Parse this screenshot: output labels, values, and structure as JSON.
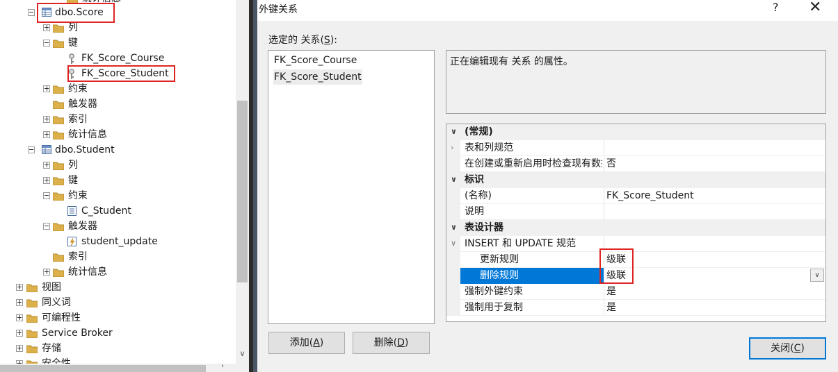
{
  "explorer": {
    "top_partial": "统计信息",
    "nodes": [
      {
        "label": "dbo.Score",
        "expander": "minus",
        "icon": "table"
      },
      {
        "label": "列",
        "expander": "plus",
        "icon": "folder"
      },
      {
        "label": "键",
        "expander": "minus",
        "icon": "folder"
      },
      {
        "label": "FK_Score_Course",
        "icon": "key"
      },
      {
        "label": "FK_Score_Student",
        "icon": "key"
      },
      {
        "label": "约束",
        "expander": "plus",
        "icon": "folder"
      },
      {
        "label": "触发器",
        "icon": "folder"
      },
      {
        "label": "索引",
        "expander": "plus",
        "icon": "folder"
      },
      {
        "label": "统计信息",
        "expander": "plus",
        "icon": "folder"
      },
      {
        "label": "dbo.Student",
        "expander": "minus",
        "icon": "table"
      },
      {
        "label": "列",
        "expander": "plus",
        "icon": "folder"
      },
      {
        "label": "键",
        "expander": "plus",
        "icon": "folder"
      },
      {
        "label": "约束",
        "expander": "minus",
        "icon": "folder"
      },
      {
        "label": "C_Student",
        "icon": "check"
      },
      {
        "label": "触发器",
        "expander": "minus",
        "icon": "folder"
      },
      {
        "label": "student_update",
        "icon": "trigger"
      },
      {
        "label": "索引",
        "icon": "folder"
      },
      {
        "label": "统计信息",
        "expander": "plus",
        "icon": "folder"
      },
      {
        "label": "视图",
        "expander": "plus",
        "icon": "folder"
      },
      {
        "label": "同义词",
        "expander": "plus",
        "icon": "folder"
      },
      {
        "label": "可编程性",
        "expander": "plus",
        "icon": "folder"
      },
      {
        "label": "Service Broker",
        "expander": "plus",
        "icon": "folder"
      },
      {
        "label": "存储",
        "expander": "plus",
        "icon": "folder"
      },
      {
        "label": "安全性",
        "expander": "plus",
        "icon": "folder"
      }
    ]
  },
  "dialog": {
    "title": "外键关系",
    "help_glyph": "?",
    "close_glyph": "✕",
    "selected_label_pre": "选定的 关系(",
    "selected_label_key": "S",
    "selected_label_post": "):",
    "relationships": [
      "FK_Score_Course",
      "FK_Score_Student"
    ],
    "description": "正在编辑现有 关系 的属性。",
    "properties": [
      {
        "type": "category",
        "name": "(常规)"
      },
      {
        "type": "expandable",
        "name": "表和列规范",
        "value": ""
      },
      {
        "type": "prop",
        "name": "在创建或重新启用时检查现有数据",
        "value": "否"
      },
      {
        "type": "category",
        "name": "标识"
      },
      {
        "type": "prop",
        "name": "(名称)",
        "value": "FK_Score_Student"
      },
      {
        "type": "prop",
        "name": "说明",
        "value": ""
      },
      {
        "type": "category",
        "name": "表设计器"
      },
      {
        "type": "expanded",
        "name": "INSERT 和 UPDATE 规范",
        "value": ""
      },
      {
        "type": "sub",
        "name": "更新规则",
        "value": "级联"
      },
      {
        "type": "sub-selected",
        "name": "删除规则",
        "value": "级联"
      },
      {
        "type": "prop",
        "name": "强制外键约束",
        "value": "是"
      },
      {
        "type": "prop",
        "name": "强制用于复制",
        "value": "是"
      }
    ],
    "buttons": {
      "add_pre": "添加(",
      "add_key": "A",
      "add_post": ")",
      "delete_pre": "删除(",
      "delete_key": "D",
      "delete_post": ")",
      "close_pre": "关闭(",
      "close_key": "C",
      "close_post": ")"
    }
  },
  "colors": {
    "highlight_red": "#e02424",
    "selection_blue": "#0078d7"
  }
}
